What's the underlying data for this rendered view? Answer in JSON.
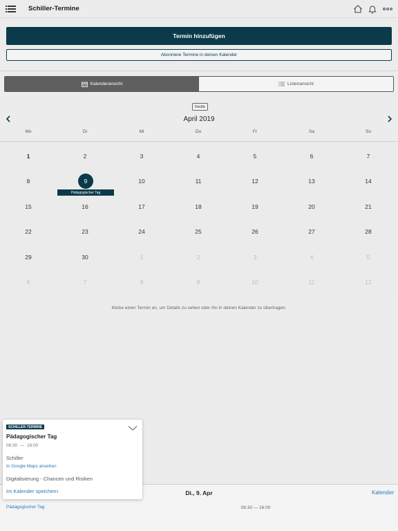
{
  "header": {
    "title": "Schiller-Termine",
    "icons": [
      "menu-icon",
      "home-icon",
      "bell-icon",
      "more-icon"
    ]
  },
  "actions": {
    "add_label": "Termin hinzufügen",
    "subscribe_label": "Abonniere Termine in deinen Kalender"
  },
  "view_toggle": {
    "calendar_label": "Kalenderansicht",
    "list_label": "Listenansicht",
    "active": "calendar"
  },
  "calendar": {
    "today_label": "heute",
    "month_label": "April 2019",
    "weekdays": [
      "Mo",
      "Di",
      "Mi",
      "Do",
      "Fr",
      "Sa",
      "So"
    ],
    "weeks": [
      [
        "1",
        "2",
        "3",
        "4",
        "5",
        "6",
        "7"
      ],
      [
        "8",
        "9",
        "10",
        "11",
        "12",
        "13",
        "14"
      ],
      [
        "15",
        "16",
        "17",
        "18",
        "19",
        "20",
        "21"
      ],
      [
        "22",
        "23",
        "24",
        "25",
        "26",
        "27",
        "28"
      ],
      [
        "29",
        "30",
        "1",
        "2",
        "3",
        "4",
        "5"
      ],
      [
        "6",
        "7",
        "8",
        "9",
        "10",
        "11",
        "12"
      ]
    ],
    "selected_day": "9",
    "event_label": "Pädagogischer Tag",
    "hint": "Klicke einen Termin an, um Details zu sehen oder ihn in deinen Kalender zu übertragen."
  },
  "bottom": {
    "date_label": "Di., 9. Apr",
    "calendar_link": "Kalender",
    "event_name": "Pädagogischer Tag",
    "event_time": "08:30 — 16:00"
  },
  "popup": {
    "badge": "SCHILLER-TERMINE",
    "title": "Pädagogischer Tag",
    "time": "08:30  —  16:00",
    "location": "Schiller",
    "maps_link": "In Google Maps ansehen",
    "description": "Digitalisierung - Chancen und Risiken",
    "save_link": "Im Kalender speichern"
  },
  "colors": {
    "primary": "#0b3a4b",
    "link": "#2a7ab8",
    "background": "#ececec"
  }
}
